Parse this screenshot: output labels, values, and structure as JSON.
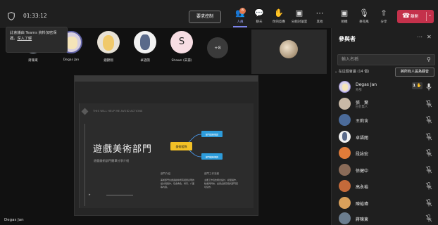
{
  "meeting": {
    "timer": "01:33:12",
    "request_control": "要求控制",
    "presenter_name": "Degas Jan"
  },
  "toolbar": [
    {
      "id": "people",
      "label": "人員",
      "icon": "people-icon",
      "badge": "8"
    },
    {
      "id": "chat",
      "label": "聊天",
      "icon": "chat-icon"
    },
    {
      "id": "reactions",
      "label": "你的反應",
      "icon": "reaction-icon"
    },
    {
      "id": "rooms",
      "label": "分組討論室",
      "icon": "rooms-icon"
    },
    {
      "id": "more",
      "label": "其他",
      "icon": "more-icon"
    },
    {
      "id": "camera",
      "label": "相機",
      "icon": "camera-off-icon"
    },
    {
      "id": "mic",
      "label": "麥克風",
      "icon": "mic-off-icon"
    },
    {
      "id": "share",
      "label": "分享",
      "icon": "share-icon"
    }
  ],
  "leave": {
    "label": "離開"
  },
  "tooltip": {
    "text": "此會議由 Teams 資料加密保護。",
    "link": "深入了解"
  },
  "gallery": [
    {
      "name": "蔣陳東"
    },
    {
      "name": "Degas Jan"
    },
    {
      "name": "鍾錦翔"
    },
    {
      "name": "卓語閱"
    },
    {
      "name": "Shawn (宋揚)",
      "initial": "S"
    }
  ],
  "gallery_more": "+8",
  "slide": {
    "header": "THIS WILL HELP ME AVOID ACTIONS",
    "title": "遊戲美術部門",
    "subtitle": "遊戲美術部門簡單分享介紹",
    "center_node": "美術組隊",
    "node_top": "部門事務規劃",
    "node_bottom": "部門業務規劃",
    "col1_title": "部門介紹",
    "col1_body": "美術部門負責遊戲中所有視覺表現的設計與製作，包含角色、場景、介面等內容。",
    "col2_title": "部門工作流程",
    "col2_body": "主要工作包含概念設計、模型製作、動畫與特效，並與企劃及程式部門密切協作。"
  },
  "panel": {
    "title": "參與者",
    "search_placeholder": "輸入名稱",
    "section": "在這個會議 (14 個)",
    "mute_all": "將所有人設為靜音",
    "hand_count": "1",
    "participants": [
      {
        "name": "Degas Jan",
        "sub": "外部"
      },
      {
        "name": "張　葉",
        "sub": "已召集人"
      },
      {
        "name": "王莉含"
      },
      {
        "name": "卓語閱"
      },
      {
        "name": "段詠宏"
      },
      {
        "name": "徐健中"
      },
      {
        "name": "高永裕"
      },
      {
        "name": "陳裕瑋"
      },
      {
        "name": "蔣陳東"
      }
    ]
  }
}
